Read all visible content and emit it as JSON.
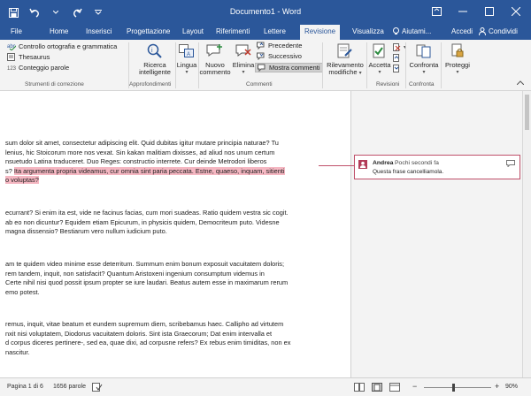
{
  "window": {
    "title": "Documento1 - Word"
  },
  "tabs": [
    {
      "label": "File"
    },
    {
      "label": "Home"
    },
    {
      "label": "Inserisci"
    },
    {
      "label": "Progettazione"
    },
    {
      "label": "Layout"
    },
    {
      "label": "Riferimenti"
    },
    {
      "label": "Lettere"
    },
    {
      "label": "Revisione"
    },
    {
      "label": "Visualizza"
    }
  ],
  "tab_right": {
    "tell_me": "Aiutami...",
    "signin": "Accedi",
    "share": "Condividi"
  },
  "ribbon": {
    "proofing": {
      "spelling": "Controllo ortografia e grammatica",
      "thesaurus": "Thesaurus",
      "wordcount": "Conteggio parole",
      "group": "Strumenti di correzione"
    },
    "insights": {
      "smart_lookup_1": "Ricerca",
      "smart_lookup_2": "intelligente",
      "group": "Approfondimenti"
    },
    "language": {
      "label": "Lingua"
    },
    "comments": {
      "new_1": "Nuovo",
      "new_2": "commento",
      "delete": "Elimina",
      "previous": "Precedente",
      "next": "Successivo",
      "show": "Mostra commenti",
      "group": "Commenti"
    },
    "tracking": {
      "label_1": "Rilevamento",
      "label_2": "modifiche"
    },
    "changes": {
      "accept": "Accetta",
      "group": "Revisioni"
    },
    "compare": {
      "label": "Confronta",
      "group": "Confronta"
    },
    "protect": {
      "label": "Proteggi"
    }
  },
  "document": {
    "para1": [
      "sum dolor sit amet, consectetur adipiscing elit. Quid dubitas igitur mutare principia naturae? Tu",
      "lenius, hic Stoicorum more nos vexat. Sin kakan malitiam dixisses, ad aliud nos unum certum",
      "nsuetudo Latina traduceret. Duo Reges: constructio interrete. Cur deinde Metrodori liberos"
    ],
    "para1_line4_pre": "s? ",
    "para1_line4_hl": "Ita argumenta propria videamus, cur omnia sint paria peccata. Estne, quaeso, inquam, sitienti",
    "para1_line5_hl": "o voluptas?",
    "para2": [
      "ecurrant? Si enim ita est, vide ne facinus facias, cum mori suadeas. Ratio quidem vestra sic cogit.",
      "ab eo non dicuntur? Equidem etiam Epicurum, in physicis quidem, Democriteum puto. Videsne",
      "magna dissensio? Bestiarum vero nullum iudicium puto."
    ],
    "para3": [
      "am te quidem video minime esse deterritum. Summum enim bonum exposuit vacuitatem doloris;",
      "rem tandem, inquit, non satisfacit? Quantum Aristoxeni ingenium consumptum videmus in",
      "Certe nihil nisi quod possit ipsum propter se iure laudari. Beatus autem esse in maximarum rerum",
      "emo potest."
    ],
    "para4": [
      "remus, inquit, vitae beatum et eundem supremum diem, scribebamus haec. Callipho ad virtutem",
      "nxit nisi voluptatem, Diodorus vacuitatem doloris. Sint ista Graecorum; Dat enim intervalla et",
      "d corpus diceres pertinere-, sed ea, quae dixi, ad corpusne refers? Ex rebus enim timiditas, non ex",
      "nascitur."
    ]
  },
  "comment": {
    "author": "Andrea",
    "when": "Pochi secondi fa",
    "text": "Questa frase cancelliamola."
  },
  "status": {
    "page": "Pagina 1 di 6",
    "words": "1656 parole",
    "zoom": "90%",
    "zoom_level": 0.9
  },
  "colors": {
    "brand": "#2b579a",
    "comment_accent": "#c0506a",
    "highlight": "#f5b7c2"
  }
}
